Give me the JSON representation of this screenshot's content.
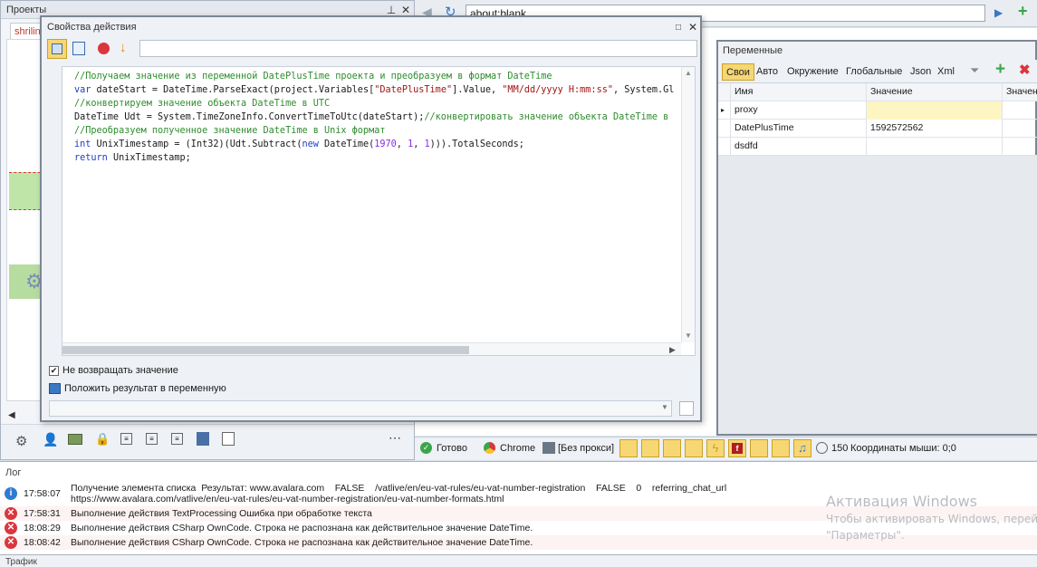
{
  "projects_panel": {
    "title": "Проекты",
    "tab_label": "shrilin"
  },
  "browser": {
    "address": "about:blank"
  },
  "dialog": {
    "title": "Свойства действия",
    "code_lines": [
      [
        {
          "c": "cm",
          "t": "//Получаем значение из переменной DatePlusTime проекта и преобразуем в формат DateTime"
        }
      ],
      [
        {
          "c": "kw",
          "t": "var"
        },
        {
          "c": "",
          "t": " dateStart = DateTime.ParseExact(project.Variables["
        },
        {
          "c": "st",
          "t": "\"DatePlusTime\""
        },
        {
          "c": "",
          "t": "].Value, "
        },
        {
          "c": "st",
          "t": "\"MM/dd/yyyy H:mm:ss\""
        },
        {
          "c": "",
          "t": ", System.Gl"
        }
      ],
      [
        {
          "c": "cm",
          "t": "//конвертируем значение объекта DateTime в UTC"
        }
      ],
      [
        {
          "c": "",
          "t": "DateTime Udt = System.TimeZoneInfo.ConvertTimeToUtc(dateStart);"
        },
        {
          "c": "cm",
          "t": "//конвертировать значение объекта DateTime в"
        }
      ],
      [
        {
          "c": "cm",
          "t": "//Преобразуем полученное значение DateTime в Unix формат"
        }
      ],
      [
        {
          "c": "kw",
          "t": "int"
        },
        {
          "c": "",
          "t": " UnixTimestamp = (Int32)(Udt.Subtract("
        },
        {
          "c": "kw",
          "t": "new"
        },
        {
          "c": "",
          "t": " DateTime("
        },
        {
          "c": "nm",
          "t": "1970"
        },
        {
          "c": "",
          "t": ", "
        },
        {
          "c": "nm",
          "t": "1"
        },
        {
          "c": "",
          "t": ", "
        },
        {
          "c": "nm",
          "t": "1"
        },
        {
          "c": "",
          "t": "))).TotalSeconds;"
        }
      ],
      [
        {
          "c": "kw",
          "t": "return"
        },
        {
          "c": "",
          "t": " UnixTimestamp;"
        }
      ]
    ],
    "checkbox_no_return_label": "Не возвращать значение",
    "checkbox_no_return_checked": true,
    "checkbox_store_result_label": "Положить результат в переменную",
    "result_variable_value": ""
  },
  "variables_panel": {
    "title": "Переменные",
    "tabs": [
      "Свои",
      "Авто",
      "Окружение",
      "Глобальные",
      "Json",
      "Xml"
    ],
    "active_tab": "Свои",
    "columns": [
      "Имя",
      "Значение",
      "Значени"
    ],
    "rows": [
      {
        "name": "proxy",
        "value": ""
      },
      {
        "name": "DatePlusTime",
        "value": "1592572562"
      },
      {
        "name": "dsdfd",
        "value": ""
      }
    ]
  },
  "statusbar": {
    "ready": "Готово",
    "browser": "Chrome",
    "proxy": "[Без прокси]",
    "count": "150",
    "mouse": "Координаты мыши: 0;0"
  },
  "log": {
    "title": "Лог",
    "entries": [
      {
        "type": "info",
        "time": "17:58:07",
        "message": "Получение элемента списка  Результат: www.avalara.com    FALSE    /vatlive/en/eu-vat-rules/eu-vat-number-registration    FALSE    0    referring_chat_url\nhttps://www.avalara.com/vatlive/en/eu-vat-rules/eu-vat-number-registration/eu-vat-number-formats.html"
      },
      {
        "type": "error",
        "time": "17:58:31",
        "message": "Выполнение действия TextProcessing Ошибка при обработке текста"
      },
      {
        "type": "error",
        "time": "18:08:29",
        "message": "Выполнение действия CSharp OwnCode. Строка не распознана как действительное значение DateTime."
      },
      {
        "type": "error",
        "time": "18:08:42",
        "message": "Выполнение действия CSharp OwnCode. Строка не распознана как действительное значение DateTime."
      }
    ]
  },
  "watermark": {
    "title": "Активация Windows",
    "line1": "Чтобы активировать Windows, перей",
    "line2": "\"Параметры\"."
  },
  "traffic": {
    "title": "Трафик"
  },
  "colors": {
    "error": "#d9363e",
    "info": "#2f7bd3",
    "active_tab": "#f7d774",
    "highlight_cell": "#fdf6c2"
  }
}
